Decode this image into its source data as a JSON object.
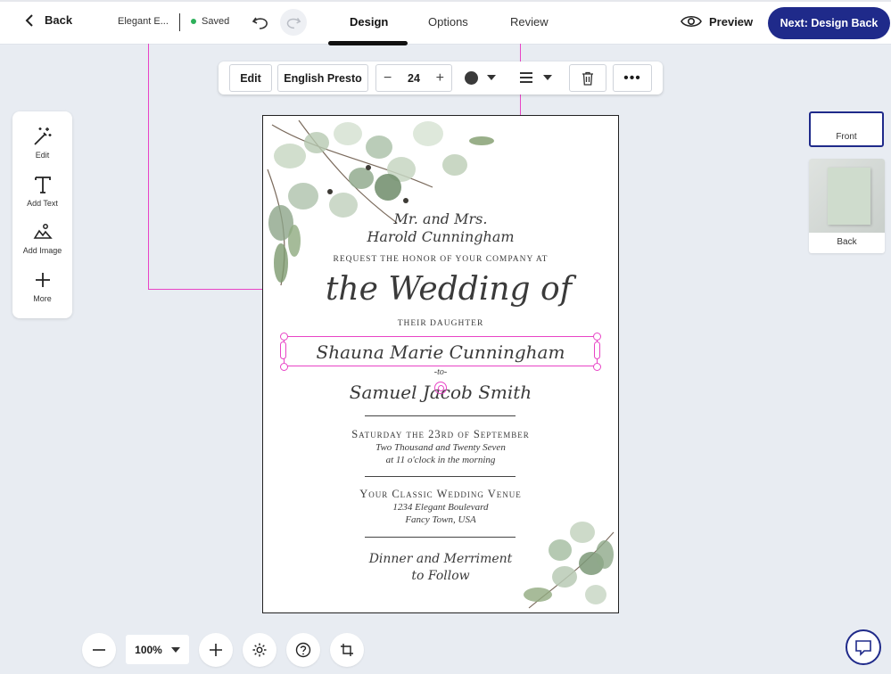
{
  "header": {
    "back_label": "Back",
    "doc_name": "Elegant E...",
    "saved_label": "Saved",
    "tabs": [
      "Design",
      "Options",
      "Review"
    ],
    "active_tab": "Design",
    "preview_label": "Preview",
    "next_label": "Next: Design Back"
  },
  "text_toolbar": {
    "edit_label": "Edit",
    "font_name": "English Presto",
    "font_size": "24",
    "text_color": "#3a3a3a"
  },
  "left_tools": [
    {
      "label": "Edit",
      "icon": "magic-wand-icon"
    },
    {
      "label": "Add Text",
      "icon": "text-icon"
    },
    {
      "label": "Add Image",
      "icon": "image-icon"
    },
    {
      "label": "More",
      "icon": "plus-icon"
    }
  ],
  "card": {
    "line1": "Mr. and Mrs.",
    "line2": "Harold Cunningham",
    "line3": "request the honor of your company at",
    "line4": "the Wedding of",
    "line5": "their daughter",
    "bride": "Shauna Marie Cunningham",
    "to": "-to-",
    "groom": "Samuel Jacob Smith",
    "date": "Saturday the 23rd of September",
    "year": "Two Thousand and Twenty Seven",
    "time": "at 11 o'clock in the morning",
    "venue": "Your Classic Wedding Venue",
    "street": "1234 Elegant Boulevard",
    "city": "Fancy Town, USA",
    "closing1": "Dinner and Merriment",
    "closing2": "to Follow"
  },
  "pages": [
    {
      "label": "Front",
      "selected": true
    },
    {
      "label": "Back",
      "selected": false
    }
  ],
  "zoom": {
    "level": "100%"
  },
  "colors": {
    "accent": "#1f2a8a",
    "selection": "#e844c6",
    "saved_dot": "#2db05a"
  }
}
